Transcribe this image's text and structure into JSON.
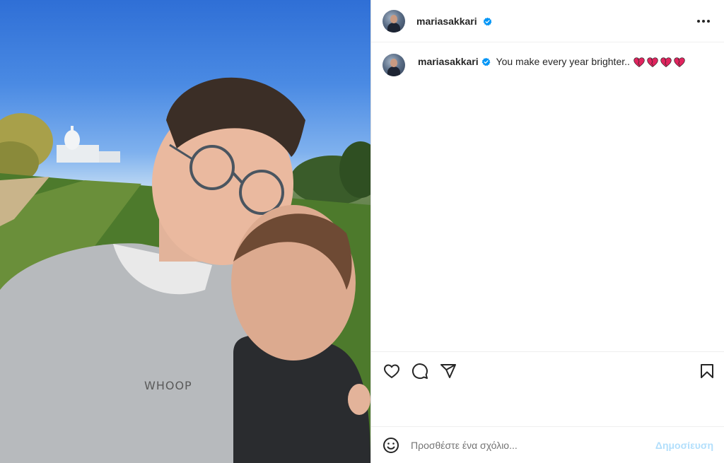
{
  "post": {
    "username": "mariasakkari",
    "verified": true,
    "caption_text": "You make every year brighter..",
    "caption_emoji": [
      "heart",
      "heart",
      "heart",
      "heart"
    ],
    "image_shirt_text": "WHOOP"
  },
  "actions": {
    "like_icon": "heart-outline-icon",
    "comment_icon": "comment-bubble-icon",
    "share_icon": "paper-plane-icon",
    "save_icon": "bookmark-icon"
  },
  "comment_box": {
    "placeholder": "Προσθέστε ένα σχόλιο...",
    "post_label": "Δημοσίευση"
  },
  "colors": {
    "verified_blue": "#0095f6",
    "heart_red": "#e0245e",
    "post_button_disabled": "#b2dffc"
  }
}
